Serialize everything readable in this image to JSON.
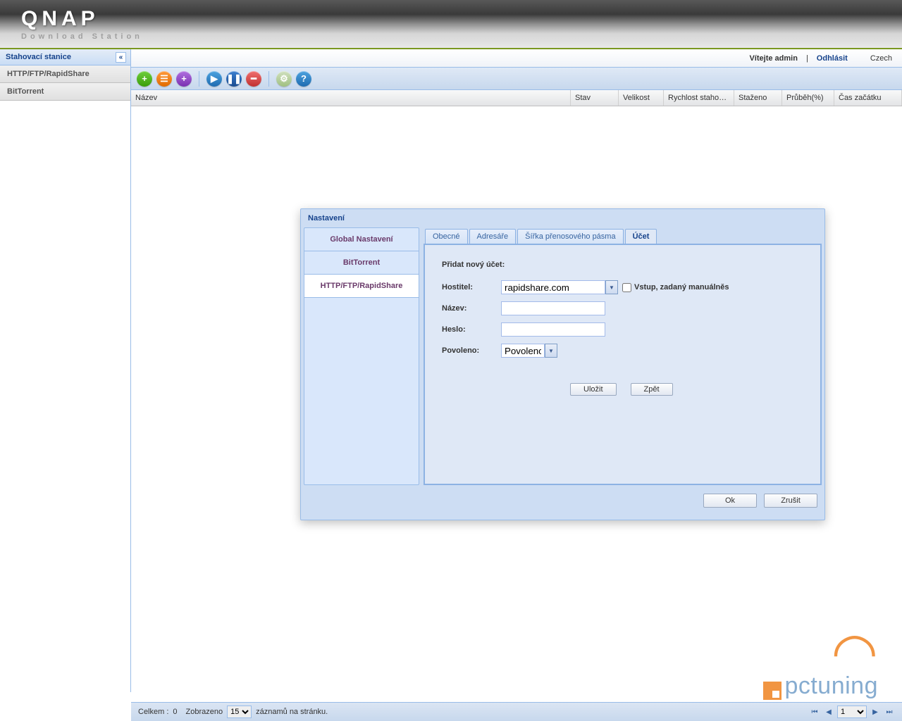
{
  "brand": {
    "name": "QNAP",
    "sub": "Download Station"
  },
  "topbar": {
    "welcome": "Vítejte admin",
    "logout": "Odhlásit",
    "language": "Czech"
  },
  "sidebar": {
    "title": "Stahovací stanice",
    "items": [
      "HTTP/FTP/RapidShare",
      "BitTorrent"
    ]
  },
  "grid_headers": {
    "name": "Název",
    "state": "Stav",
    "size": "Velikost",
    "speed": "Rychlost staho…",
    "downloaded": "Staženo",
    "progress": "Průběh(%)",
    "start": "Čas začátku"
  },
  "modal": {
    "title": "Nastavení",
    "nav": [
      "Global Nastavení",
      "BitTorrent",
      "HTTP/FTP/RapidShare"
    ],
    "tabs": [
      "Obecné",
      "Adresáře",
      "Šířka přenosového pásma",
      "Účet"
    ],
    "active_tab": "Účet",
    "form": {
      "add_account_label": "Přidat nový účet:",
      "host_label": "Hostitel:",
      "host_value": "rapidshare.com",
      "manual_label": "Vstup, zadaný manuálněs",
      "name_label": "Název:",
      "name_value": "",
      "password_label": "Heslo:",
      "password_value": "",
      "enabled_label": "Povoleno:",
      "enabled_options": [
        "Povoleno"
      ],
      "save": "Uložit",
      "back": "Zpět"
    },
    "ok": "Ok",
    "cancel": "Zrušit"
  },
  "statusbar": {
    "total_label": "Celkem :",
    "total_value": "0",
    "shown_label": "Zobrazeno",
    "per_page": "15",
    "records_label": "záznamů na stránku.",
    "page": "1"
  },
  "watermark": {
    "text": "pctuning"
  }
}
